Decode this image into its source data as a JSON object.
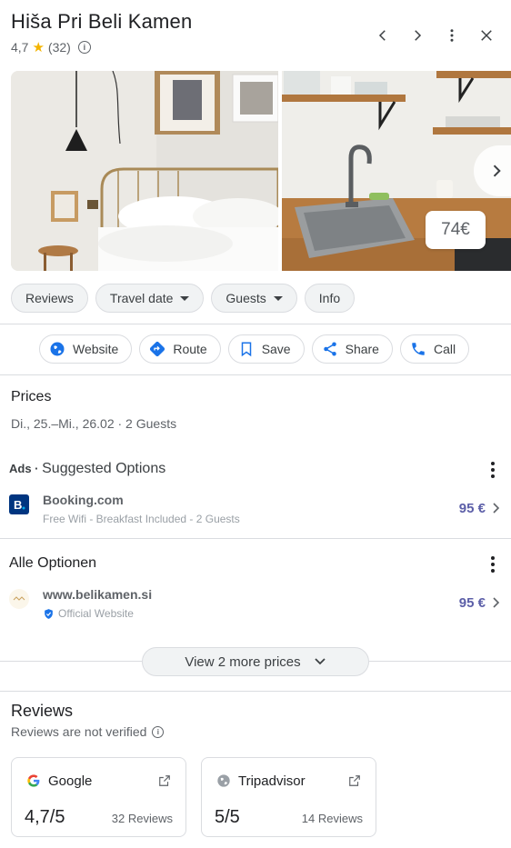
{
  "header": {
    "title": "Hiša Pri Beli Kamen",
    "rating": "4,7",
    "review_count": "(32)"
  },
  "top_icons": [
    "chevron-left-icon",
    "chevron-right-icon",
    "more-vert-icon",
    "close-icon"
  ],
  "photos": {
    "price_tag": "74€"
  },
  "chips": [
    "Reviews",
    "Travel date",
    "Guests",
    "Info"
  ],
  "actions": [
    "Website",
    "Route",
    "Save",
    "Share",
    "Call"
  ],
  "prices": {
    "title": "Prices",
    "dates": "Di., 25.–Mi., 26.02 · 2 Guests",
    "ads_label": "Ads",
    "ads_sep": " · ",
    "suggested_title": "Suggested Options",
    "all_title": "Alle Optionen",
    "more_button": "View 2 more prices"
  },
  "suggested": [
    {
      "name": "Booking.com",
      "sub": "Free Wifi - Breakfast Included - 2 Guests",
      "price": "95 €"
    }
  ],
  "all_options": [
    {
      "name": "www.belikamen.si",
      "sub": "Official Website",
      "price": "95 €"
    }
  ],
  "reviews": {
    "title": "Reviews",
    "subtitle": "Reviews are not verified",
    "cards": [
      {
        "name": "Google",
        "score": "4,7/5",
        "count": "32 Reviews"
      },
      {
        "name": "Tripadvisor",
        "score": "5/5",
        "count": "14 Reviews"
      }
    ]
  },
  "colors": {
    "star": "#f4b400",
    "accent_blue": "#1a73e8",
    "price": "#5c5fa8",
    "booking_blue": "#003580"
  }
}
